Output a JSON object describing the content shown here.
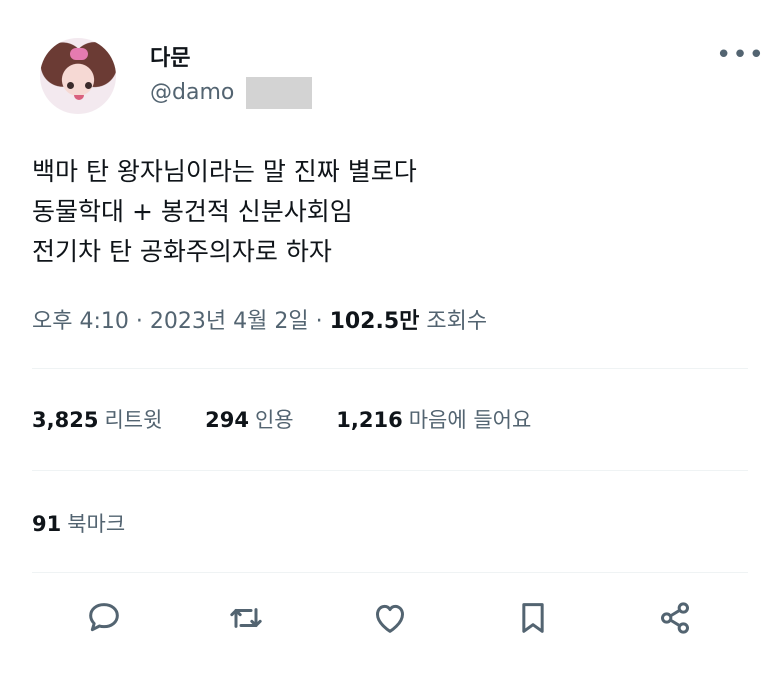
{
  "user": {
    "display_name": "다문",
    "handle": "@damo"
  },
  "tweet": {
    "lines": [
      "백마 탄 왕자님이라는 말 진짜 별로다",
      "동물학대 + 봉건적 신분사회임",
      "전기차 탄 공화주의자로 하자"
    ]
  },
  "meta": {
    "time": "오후 4:10",
    "separator": " · ",
    "date": "2023년 4월 2일",
    "views_count": "102.5만",
    "views_label": "조회수"
  },
  "stats": {
    "retweets_count": "3,825",
    "retweets_label": "리트윗",
    "quotes_count": "294",
    "quotes_label": "인용",
    "likes_count": "1,216",
    "likes_label": "마음에 들어요",
    "bookmarks_count": "91",
    "bookmarks_label": "북마크"
  },
  "more_icon": "more-horizontal-icon",
  "icons": [
    "reply-icon",
    "retweet-icon",
    "like-icon",
    "bookmark-icon",
    "share-icon"
  ],
  "colors": {
    "text": "#0f1419",
    "secondary": "#536471",
    "divider": "#eff3f4"
  }
}
